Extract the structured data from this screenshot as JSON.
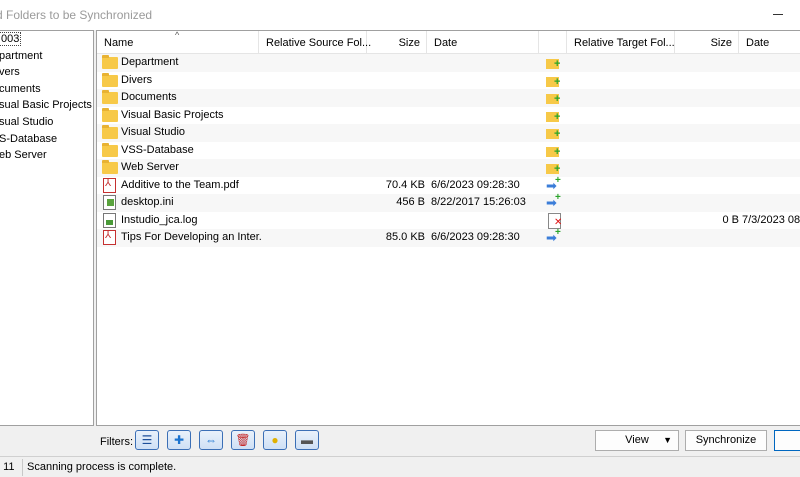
{
  "window": {
    "title": "d Folders to be Synchronized"
  },
  "tree": {
    "items": [
      "003",
      "partment",
      "vers",
      "cuments",
      "sual Basic Projects",
      "sual Studio",
      "S-Database",
      "eb Server"
    ]
  },
  "columns": {
    "name": "Name",
    "rel_source": "Relative Source Fol...",
    "size": "Size",
    "date": "Date",
    "rel_target": "Relative Target Fol...",
    "tsize": "Size",
    "tdate": "Date"
  },
  "rows": [
    {
      "icon": "folder-icon",
      "name": "Department",
      "size": "",
      "date": "",
      "action": "new-folder-icon",
      "tsize": "",
      "tdate": ""
    },
    {
      "icon": "folder-icon",
      "name": "Divers",
      "size": "",
      "date": "",
      "action": "new-folder-icon",
      "tsize": "",
      "tdate": ""
    },
    {
      "icon": "folder-icon",
      "name": "Documents",
      "size": "",
      "date": "",
      "action": "new-folder-icon",
      "tsize": "",
      "tdate": ""
    },
    {
      "icon": "folder-icon",
      "name": "Visual Basic Projects",
      "size": "",
      "date": "",
      "action": "new-folder-icon",
      "tsize": "",
      "tdate": ""
    },
    {
      "icon": "folder-icon",
      "name": "Visual Studio",
      "size": "",
      "date": "",
      "action": "new-folder-icon",
      "tsize": "",
      "tdate": ""
    },
    {
      "icon": "folder-icon",
      "name": "VSS-Database",
      "size": "",
      "date": "",
      "action": "new-folder-icon",
      "tsize": "",
      "tdate": ""
    },
    {
      "icon": "folder-icon",
      "name": "Web Server",
      "size": "",
      "date": "",
      "action": "new-folder-icon",
      "tsize": "",
      "tdate": ""
    },
    {
      "icon": "pdf-file-icon",
      "name": "Additive to the Team.pdf",
      "size": "70.4 KB",
      "date": "6/6/2023  09:28:30",
      "action": "copy-right-icon",
      "tsize": "",
      "tdate": ""
    },
    {
      "icon": "ini-file-icon",
      "name": "desktop.ini",
      "size": "456 B",
      "date": "8/22/2017  15:26:03",
      "action": "copy-right-icon",
      "tsize": "",
      "tdate": ""
    },
    {
      "icon": "log-file-icon",
      "name": "Instudio_jca.log",
      "size": "",
      "date": "",
      "action": "delete-file-icon",
      "tsize": "0 B",
      "tdate": "7/3/2023  08"
    },
    {
      "icon": "pdf-file-icon",
      "name": "Tips For Developing an Inter...",
      "size": "85.0 KB",
      "date": "6/6/2023  09:28:30",
      "action": "copy-right-icon",
      "tsize": "",
      "tdate": ""
    }
  ],
  "bottom": {
    "filters_label": "Filters:",
    "view_label": "View",
    "sync_label": "Synchronize"
  },
  "status": {
    "count": ": 11",
    "message": "Scanning process is complete."
  }
}
